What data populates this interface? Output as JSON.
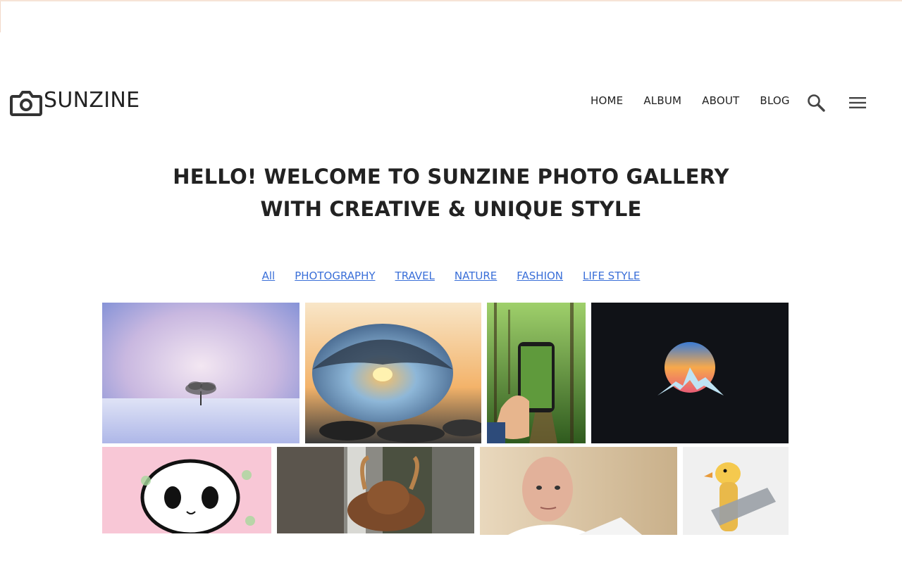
{
  "brand": {
    "name": "SUNZINE",
    "logo_icon": "camera-icon"
  },
  "nav": {
    "items": [
      "HOME",
      "ALBUM",
      "ABOUT",
      "BLOG"
    ],
    "search_icon": "search-icon",
    "menu_icon": "hamburger-menu-icon"
  },
  "hero": {
    "line1": "HELLO! WELCOME TO SUNZINE PHOTO GALLERY",
    "line2": "WITH CREATIVE & UNIQUE STYLE"
  },
  "filters": [
    "All",
    "PHOTOGRAPHY",
    "TRAVEL",
    "NATURE",
    "FASHION",
    "LIFE STYLE"
  ],
  "colors": {
    "text": "#222222",
    "link": "#3a6fd8",
    "background": "#ffffff"
  },
  "gallery": [
    {
      "subject": "lone tree in snowy lavender landscape"
    },
    {
      "subject": "glass ball reflecting sunset over pebbles"
    },
    {
      "subject": "hand holding phone in green forest path"
    },
    {
      "subject": "mountain sunrise logo on dark background"
    },
    {
      "subject": "cartoon panda-face drawing on pink background"
    },
    {
      "subject": "bronze bull statue on city street"
    },
    {
      "subject": "portrait of bald man"
    },
    {
      "subject": "yellow duckling with tape"
    }
  ]
}
